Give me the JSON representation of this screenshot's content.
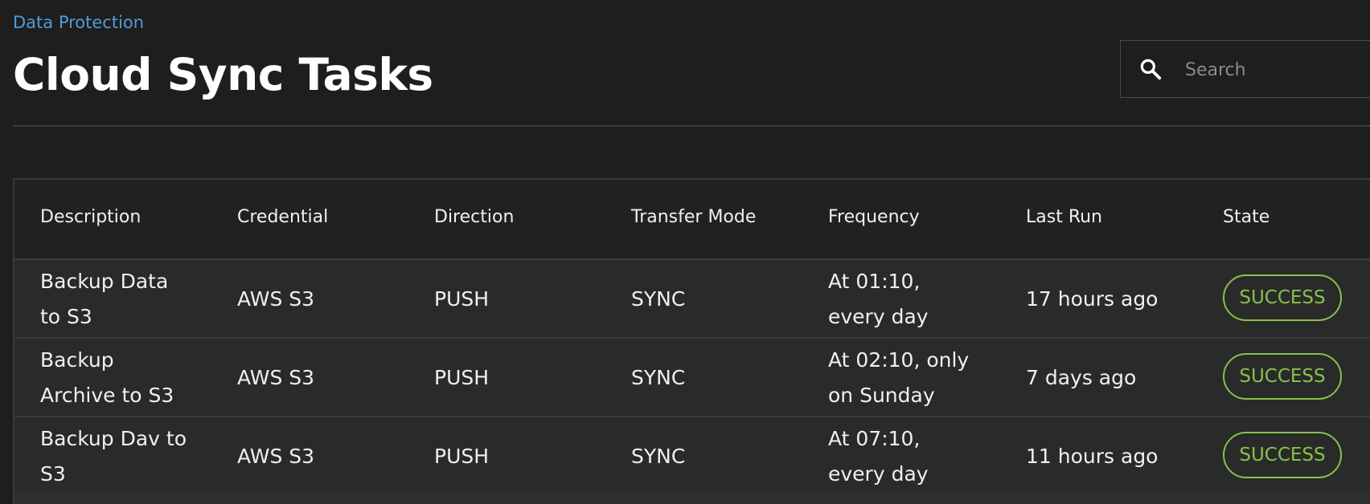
{
  "breadcrumb": "Data Protection",
  "page_title": "Cloud Sync Tasks",
  "search": {
    "placeholder": "Search",
    "value": "",
    "icon": "search-icon"
  },
  "table": {
    "columns": [
      "Description",
      "Credential",
      "Direction",
      "Transfer Mode",
      "Frequency",
      "Last Run",
      "State"
    ],
    "rows": [
      {
        "description_lines": [
          "Backup Data",
          "to S3"
        ],
        "credential": "AWS S3",
        "direction": "PUSH",
        "transfer_mode": "SYNC",
        "frequency_lines": [
          "At 01:10,",
          "every day"
        ],
        "last_run": "17 hours ago",
        "state": "SUCCESS"
      },
      {
        "description_lines": [
          "Backup",
          "Archive to S3"
        ],
        "credential": "AWS S3",
        "direction": "PUSH",
        "transfer_mode": "SYNC",
        "frequency_lines": [
          "At 02:10, only",
          "on Sunday"
        ],
        "last_run": "7 days ago",
        "state": "SUCCESS"
      },
      {
        "description_lines": [
          "Backup Dav to",
          "S3"
        ],
        "credential": "AWS S3",
        "direction": "PUSH",
        "transfer_mode": "SYNC",
        "frequency_lines": [
          "At 07:10,",
          "every day"
        ],
        "last_run": "11 hours ago",
        "state": "SUCCESS"
      }
    ]
  },
  "colors": {
    "background": "#1e1e1e",
    "link": "#4f9bd9",
    "success": "#86c24a"
  }
}
